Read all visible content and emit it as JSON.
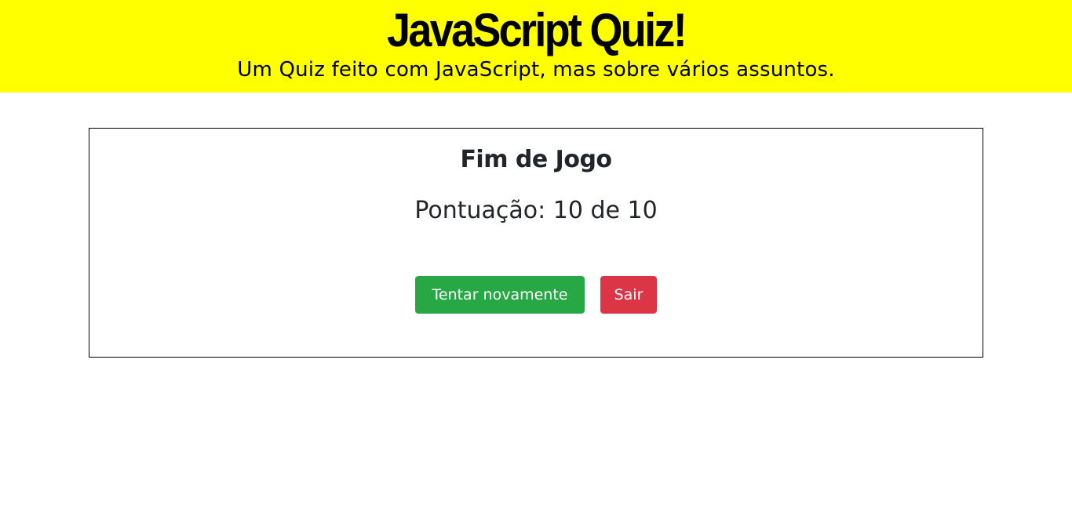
{
  "header": {
    "title": "JavaScript Quiz!",
    "subtitle": "Um Quiz feito com JavaScript, mas sobre vários assuntos."
  },
  "result": {
    "heading": "Fim de Jogo",
    "score_text": "Pontuação: 10 de 10",
    "score": 10,
    "total": 10
  },
  "actions": {
    "retry_label": "Tentar novamente",
    "exit_label": "Sair"
  },
  "colors": {
    "header_bg": "#ffff00",
    "retry_button": "#28a745",
    "exit_button": "#dc3545"
  }
}
